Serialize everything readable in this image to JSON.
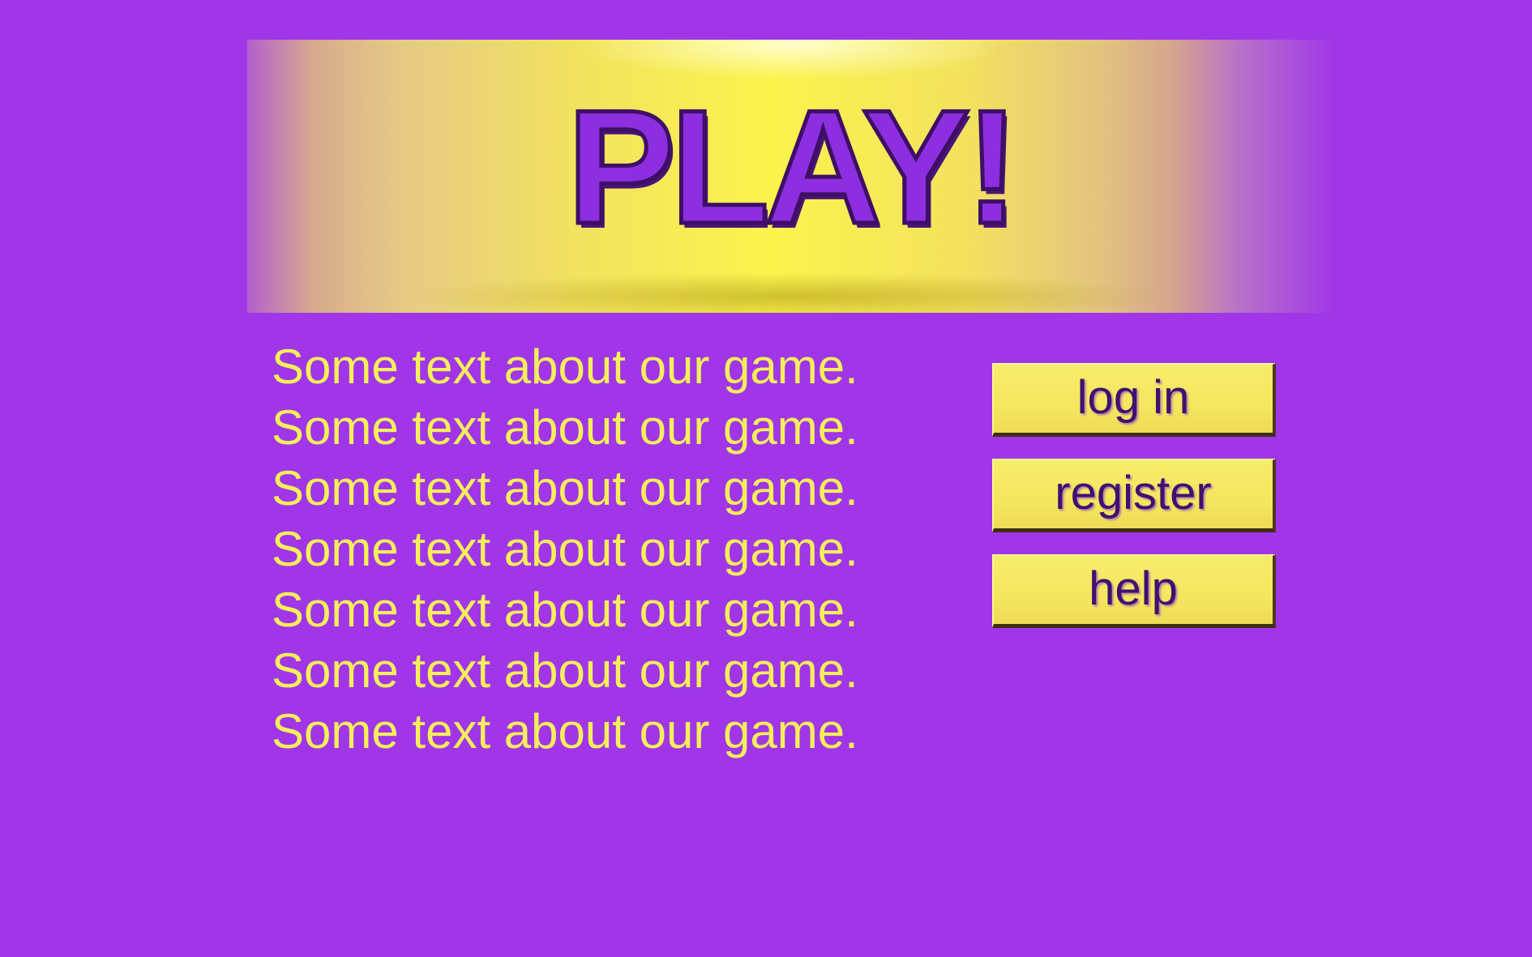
{
  "header": {
    "title": "PLAY!"
  },
  "about": {
    "lines": [
      "Some text about our game.",
      "Some text about our game.",
      "Some text about our game.",
      "Some text about our game.",
      "Some text about our game.",
      "Some text about our game.",
      "Some text about our game."
    ]
  },
  "menu": {
    "login_label": "log in",
    "register_label": "register",
    "help_label": "help"
  },
  "colors": {
    "background": "#a036e8",
    "text_yellow": "#f4ef5a",
    "button_yellow": "#f5e65f",
    "title_purple": "#8d2ee0"
  }
}
